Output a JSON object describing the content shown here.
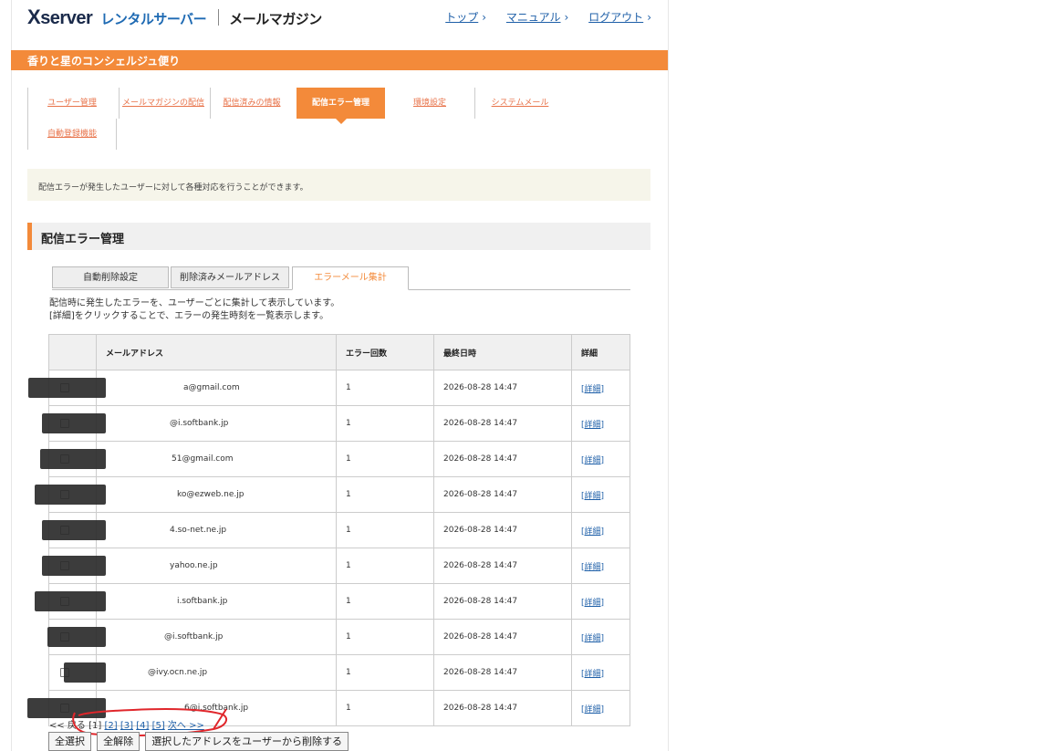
{
  "header": {
    "logo_x": "X",
    "logo_server": "server",
    "logo_rental": "レンタルサーバー",
    "logo_product": "メールマガジン",
    "links": [
      "トップ",
      "マニュアル",
      "ログアウト"
    ]
  },
  "site_title": "香りと星のコンシェルジュ便り",
  "nav": {
    "items": [
      "ユーザー管理",
      "メールマガジンの配信",
      "配信済みの情報",
      "配信エラー管理",
      "環境設定",
      "システムメール",
      "自動登録機能"
    ],
    "active": "配信エラー管理"
  },
  "info_text": "配信エラーが発生したユーザーに対して各種対応を行うことができます。",
  "section_title": "配信エラー管理",
  "tabs": [
    "自動削除設定",
    "削除済みメールアドレス",
    "エラーメール集計"
  ],
  "active_tab": "エラーメール集計",
  "description": [
    "配信時に発生したエラーを、ユーザーごとに集計して表示しています。",
    "[詳細]をクリックすることで、エラーの発生時刻を一覧表示します。"
  ],
  "table": {
    "headers": [
      "",
      "メールアドレス",
      "エラー回数",
      "最終日時",
      "詳細"
    ],
    "rows": [
      {
        "email": "a@gmail.com",
        "count": "1",
        "date": "2026-08-28 14:47",
        "detail": "[詳細]"
      },
      {
        "email": "@i.softbank.jp",
        "count": "1",
        "date": "2026-08-28 14:47",
        "detail": "[詳細]"
      },
      {
        "email": "51@gmail.com",
        "count": "1",
        "date": "2026-08-28 14:47",
        "detail": "[詳細]"
      },
      {
        "email": "ko@ezweb.ne.jp",
        "count": "1",
        "date": "2026-08-28 14:47",
        "detail": "[詳細]"
      },
      {
        "email": "4.so-net.ne.jp",
        "count": "1",
        "date": "2026-08-28 14:47",
        "detail": "[詳細]"
      },
      {
        "email": "yahoo.ne.jp",
        "count": "1",
        "date": "2026-08-28 14:47",
        "detail": "[詳細]"
      },
      {
        "email": "i.softbank.jp",
        "count": "1",
        "date": "2026-08-28 14:47",
        "detail": "[詳細]"
      },
      {
        "email": "@i.softbank.jp",
        "count": "1",
        "date": "2026-08-28 14:47",
        "detail": "[詳細]"
      },
      {
        "email": "@ivy.ocn.ne.jp",
        "count": "1",
        "date": "2026-08-28 14:47",
        "detail": "[詳細]"
      },
      {
        "email": "6@i.softbank.jp",
        "count": "1",
        "date": "2026-08-28 14:47",
        "detail": "[詳細]"
      }
    ]
  },
  "pager": {
    "prev": "<< 戻る",
    "current": "[1]",
    "pages": [
      "[2]",
      "[3]",
      "[4]",
      "[5]"
    ],
    "next": "次へ >>"
  },
  "buttons": [
    "全選択",
    "全解除",
    "選択したアドレスをユーザーから削除する"
  ],
  "colors": {
    "accent": "#f38a3a",
    "link": "#1e5fa8"
  }
}
